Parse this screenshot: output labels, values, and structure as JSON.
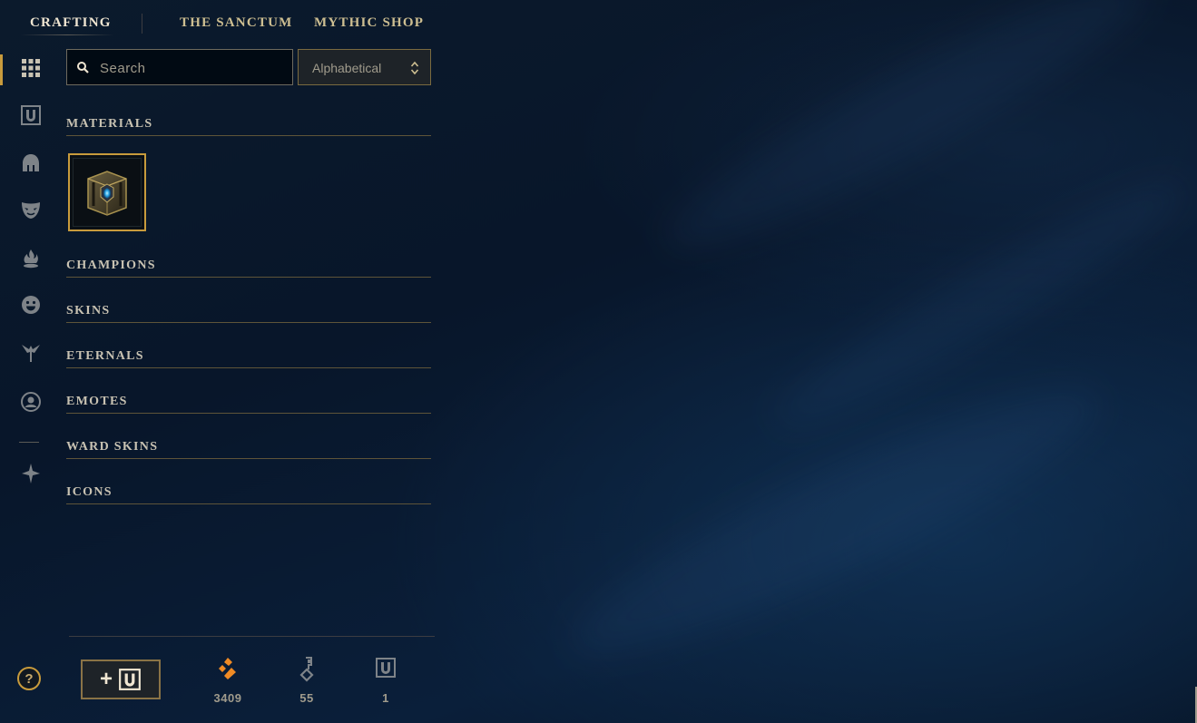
{
  "nav": {
    "tabs": [
      {
        "label": "CRAFTING",
        "active": true
      },
      {
        "label": "THE SANCTUM",
        "active": false
      },
      {
        "label": "MYTHIC SHOP",
        "active": false
      }
    ]
  },
  "sidebar": {
    "items": [
      {
        "icon": "grid-icon",
        "active": true
      },
      {
        "icon": "chest-icon",
        "active": false
      },
      {
        "icon": "champion-helmet-icon",
        "active": false
      },
      {
        "icon": "skin-mask-icon",
        "active": false
      },
      {
        "icon": "ward-flame-icon",
        "active": false
      },
      {
        "icon": "emote-face-icon",
        "active": false
      },
      {
        "icon": "eternals-icon",
        "active": false
      },
      {
        "icon": "profile-icon",
        "active": false
      },
      {
        "icon": "tft-icon",
        "active": false
      }
    ],
    "help_label": "?"
  },
  "search": {
    "placeholder": "Search",
    "value": ""
  },
  "sort": {
    "selected": "Alphabetical"
  },
  "categories": [
    {
      "label": "MATERIALS",
      "items": [
        {
          "icon": "hextech-chest-icon"
        }
      ]
    },
    {
      "label": "CHAMPIONS",
      "items": []
    },
    {
      "label": "SKINS",
      "items": []
    },
    {
      "label": "ETERNALS",
      "items": []
    },
    {
      "label": "EMOTES",
      "items": []
    },
    {
      "label": "WARD SKINS",
      "items": []
    },
    {
      "label": "ICONS",
      "items": []
    }
  ],
  "footer": {
    "add_chest_label": "+",
    "currencies": [
      {
        "icon": "orange-essence-icon",
        "amount": "3409"
      },
      {
        "icon": "key-fragment-icon",
        "amount": "55"
      },
      {
        "icon": "chest-icon",
        "amount": "1"
      }
    ]
  },
  "colors": {
    "gold": "#c89b3c",
    "gold_text": "#cdbe91",
    "orange_essence": "#f08a24",
    "background": "#0a1628"
  }
}
